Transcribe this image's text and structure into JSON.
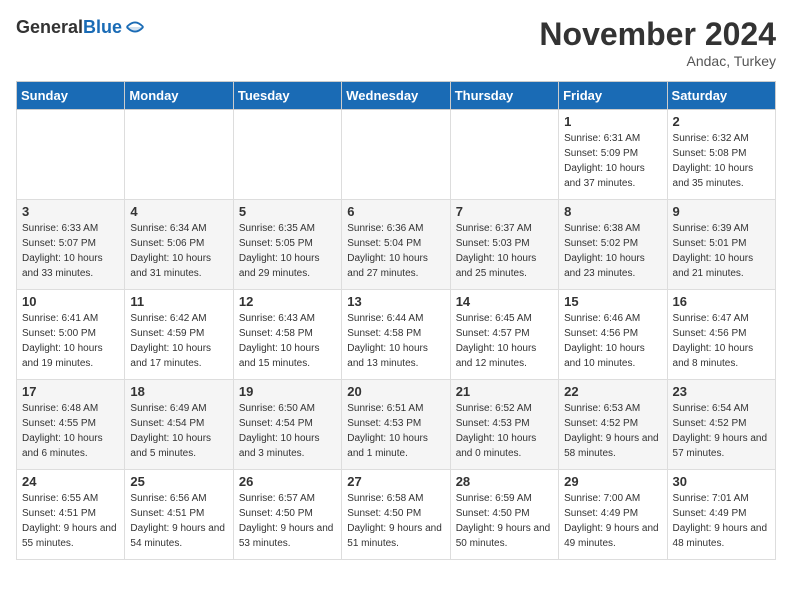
{
  "header": {
    "logo_general": "General",
    "logo_blue": "Blue",
    "month": "November 2024",
    "location": "Andac, Turkey"
  },
  "weekdays": [
    "Sunday",
    "Monday",
    "Tuesday",
    "Wednesday",
    "Thursday",
    "Friday",
    "Saturday"
  ],
  "weeks": [
    [
      {
        "day": "",
        "content": ""
      },
      {
        "day": "",
        "content": ""
      },
      {
        "day": "",
        "content": ""
      },
      {
        "day": "",
        "content": ""
      },
      {
        "day": "",
        "content": ""
      },
      {
        "day": "1",
        "content": "Sunrise: 6:31 AM\nSunset: 5:09 PM\nDaylight: 10 hours and 37 minutes."
      },
      {
        "day": "2",
        "content": "Sunrise: 6:32 AM\nSunset: 5:08 PM\nDaylight: 10 hours and 35 minutes."
      }
    ],
    [
      {
        "day": "3",
        "content": "Sunrise: 6:33 AM\nSunset: 5:07 PM\nDaylight: 10 hours and 33 minutes."
      },
      {
        "day": "4",
        "content": "Sunrise: 6:34 AM\nSunset: 5:06 PM\nDaylight: 10 hours and 31 minutes."
      },
      {
        "day": "5",
        "content": "Sunrise: 6:35 AM\nSunset: 5:05 PM\nDaylight: 10 hours and 29 minutes."
      },
      {
        "day": "6",
        "content": "Sunrise: 6:36 AM\nSunset: 5:04 PM\nDaylight: 10 hours and 27 minutes."
      },
      {
        "day": "7",
        "content": "Sunrise: 6:37 AM\nSunset: 5:03 PM\nDaylight: 10 hours and 25 minutes."
      },
      {
        "day": "8",
        "content": "Sunrise: 6:38 AM\nSunset: 5:02 PM\nDaylight: 10 hours and 23 minutes."
      },
      {
        "day": "9",
        "content": "Sunrise: 6:39 AM\nSunset: 5:01 PM\nDaylight: 10 hours and 21 minutes."
      }
    ],
    [
      {
        "day": "10",
        "content": "Sunrise: 6:41 AM\nSunset: 5:00 PM\nDaylight: 10 hours and 19 minutes."
      },
      {
        "day": "11",
        "content": "Sunrise: 6:42 AM\nSunset: 4:59 PM\nDaylight: 10 hours and 17 minutes."
      },
      {
        "day": "12",
        "content": "Sunrise: 6:43 AM\nSunset: 4:58 PM\nDaylight: 10 hours and 15 minutes."
      },
      {
        "day": "13",
        "content": "Sunrise: 6:44 AM\nSunset: 4:58 PM\nDaylight: 10 hours and 13 minutes."
      },
      {
        "day": "14",
        "content": "Sunrise: 6:45 AM\nSunset: 4:57 PM\nDaylight: 10 hours and 12 minutes."
      },
      {
        "day": "15",
        "content": "Sunrise: 6:46 AM\nSunset: 4:56 PM\nDaylight: 10 hours and 10 minutes."
      },
      {
        "day": "16",
        "content": "Sunrise: 6:47 AM\nSunset: 4:56 PM\nDaylight: 10 hours and 8 minutes."
      }
    ],
    [
      {
        "day": "17",
        "content": "Sunrise: 6:48 AM\nSunset: 4:55 PM\nDaylight: 10 hours and 6 minutes."
      },
      {
        "day": "18",
        "content": "Sunrise: 6:49 AM\nSunset: 4:54 PM\nDaylight: 10 hours and 5 minutes."
      },
      {
        "day": "19",
        "content": "Sunrise: 6:50 AM\nSunset: 4:54 PM\nDaylight: 10 hours and 3 minutes."
      },
      {
        "day": "20",
        "content": "Sunrise: 6:51 AM\nSunset: 4:53 PM\nDaylight: 10 hours and 1 minute."
      },
      {
        "day": "21",
        "content": "Sunrise: 6:52 AM\nSunset: 4:53 PM\nDaylight: 10 hours and 0 minutes."
      },
      {
        "day": "22",
        "content": "Sunrise: 6:53 AM\nSunset: 4:52 PM\nDaylight: 9 hours and 58 minutes."
      },
      {
        "day": "23",
        "content": "Sunrise: 6:54 AM\nSunset: 4:52 PM\nDaylight: 9 hours and 57 minutes."
      }
    ],
    [
      {
        "day": "24",
        "content": "Sunrise: 6:55 AM\nSunset: 4:51 PM\nDaylight: 9 hours and 55 minutes."
      },
      {
        "day": "25",
        "content": "Sunrise: 6:56 AM\nSunset: 4:51 PM\nDaylight: 9 hours and 54 minutes."
      },
      {
        "day": "26",
        "content": "Sunrise: 6:57 AM\nSunset: 4:50 PM\nDaylight: 9 hours and 53 minutes."
      },
      {
        "day": "27",
        "content": "Sunrise: 6:58 AM\nSunset: 4:50 PM\nDaylight: 9 hours and 51 minutes."
      },
      {
        "day": "28",
        "content": "Sunrise: 6:59 AM\nSunset: 4:50 PM\nDaylight: 9 hours and 50 minutes."
      },
      {
        "day": "29",
        "content": "Sunrise: 7:00 AM\nSunset: 4:49 PM\nDaylight: 9 hours and 49 minutes."
      },
      {
        "day": "30",
        "content": "Sunrise: 7:01 AM\nSunset: 4:49 PM\nDaylight: 9 hours and 48 minutes."
      }
    ]
  ]
}
